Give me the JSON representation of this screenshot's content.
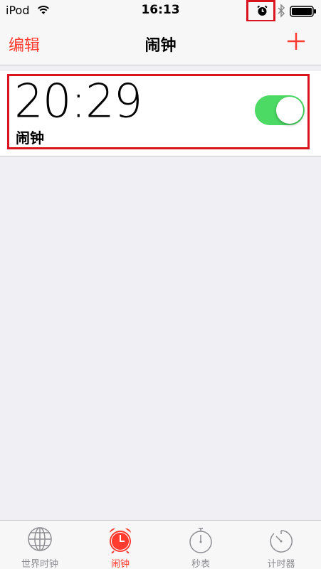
{
  "status_bar": {
    "carrier": "iPod",
    "time": "16:13",
    "icons": [
      "wifi-icon",
      "alarm-icon",
      "bluetooth-icon",
      "battery-icon"
    ]
  },
  "nav": {
    "edit_label": "编辑",
    "title": "闹钟",
    "add_icon": "plus-icon"
  },
  "alarms": [
    {
      "time": "20:29",
      "label": "闹钟",
      "enabled": true
    }
  ],
  "tabs": [
    {
      "label": "世界时钟",
      "icon": "globe-icon",
      "active": false
    },
    {
      "label": "闹钟",
      "icon": "alarm-clock-icon",
      "active": true
    },
    {
      "label": "秒表",
      "icon": "stopwatch-icon",
      "active": false
    },
    {
      "label": "计时器",
      "icon": "timer-icon",
      "active": false
    }
  ],
  "colors": {
    "accent": "#ff3b30",
    "toggle_on": "#4cd964",
    "highlight": "#d9141e",
    "background": "#efeff4"
  }
}
